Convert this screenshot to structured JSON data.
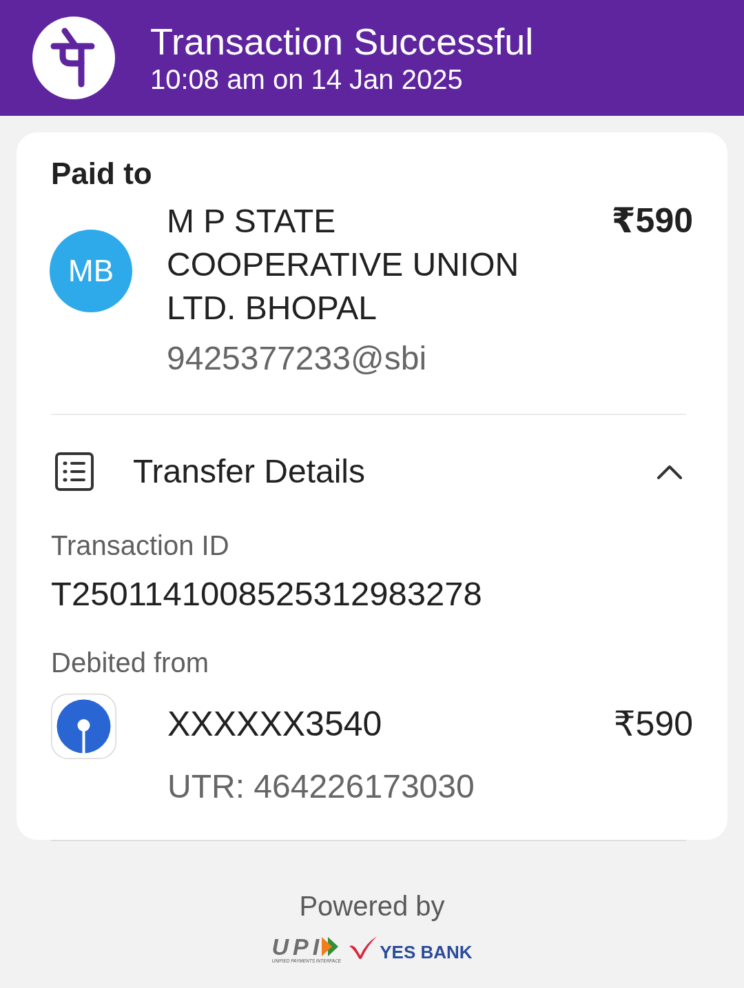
{
  "header": {
    "title": "Transaction Successful",
    "timestamp": "10:08 am on 14 Jan 2025"
  },
  "paid_to": {
    "label": "Paid to",
    "avatar": "MB",
    "name": "M P STATE COOPERATIVE UNION LTD. BHOPAL",
    "upi_id": "9425377233@sbi",
    "amount": "₹590"
  },
  "transfer_details": {
    "title": "Transfer Details",
    "expanded": true,
    "transaction_id_label": "Transaction ID",
    "transaction_id": "T2501141008525312983278",
    "debited_from_label": "Debited from",
    "account": "XXXXXX3540",
    "amount": "₹590",
    "utr": "UTR: 464226173030"
  },
  "footer": {
    "powered_by": "Powered by",
    "upi_wordmark": "UPI",
    "upi_tagline": "UNIFIED PAYMENTS INTERFACE",
    "bank_wordmark": "YES BANK"
  }
}
